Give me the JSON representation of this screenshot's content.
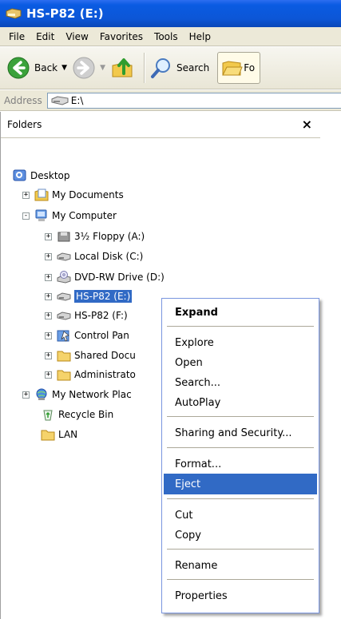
{
  "window": {
    "title": "HS-P82 (E:)"
  },
  "menu": [
    "File",
    "Edit",
    "View",
    "Favorites",
    "Tools",
    "Help"
  ],
  "toolbar": {
    "back_label": "Back",
    "search_label": "Search",
    "folders_label": "Fo"
  },
  "address": {
    "label": "Address",
    "value": "E:\\"
  },
  "folders_pane": {
    "title": "Folders",
    "close": "×",
    "tree": [
      {
        "label": "Desktop",
        "icon": "desktop-icon",
        "expander": ""
      },
      {
        "label": "My Documents",
        "icon": "my-documents-icon",
        "expander": "+"
      },
      {
        "label": "My Computer",
        "icon": "my-computer-icon",
        "expander": "-"
      },
      {
        "label": "3½ Floppy (A:)",
        "icon": "floppy-icon",
        "expander": "+"
      },
      {
        "label": "Local Disk (C:)",
        "icon": "disk-icon",
        "expander": "+"
      },
      {
        "label": "DVD-RW Drive (D:)",
        "icon": "dvd-icon",
        "expander": "+"
      },
      {
        "label": "HS-P82 (E:)",
        "icon": "disk-icon",
        "expander": "+"
      },
      {
        "label": "HS-P82 (F:)",
        "icon": "disk-icon",
        "expander": "+"
      },
      {
        "label": "Control Pan",
        "icon": "control-panel-icon",
        "expander": "+"
      },
      {
        "label": "Shared Docu",
        "icon": "folder-icon",
        "expander": "+"
      },
      {
        "label": "Administrato",
        "icon": "folder-icon",
        "expander": "+"
      },
      {
        "label": "My Network Plac",
        "icon": "network-icon",
        "expander": "+"
      },
      {
        "label": "Recycle Bin",
        "icon": "recycle-bin-icon",
        "expander": ""
      },
      {
        "label": "LAN",
        "icon": "folder-icon",
        "expander": ""
      }
    ]
  },
  "context_menu": {
    "items": [
      "Expand",
      "Explore",
      "Open",
      "Search...",
      "AutoPlay",
      "Sharing and Security...",
      "Format...",
      "Eject",
      "Cut",
      "Copy",
      "Rename",
      "Properties"
    ],
    "highlighted": "Eject"
  },
  "colors": {
    "titlebar": "#0a5be2",
    "selection": "#316ac5",
    "chrome": "#ece9d8"
  }
}
